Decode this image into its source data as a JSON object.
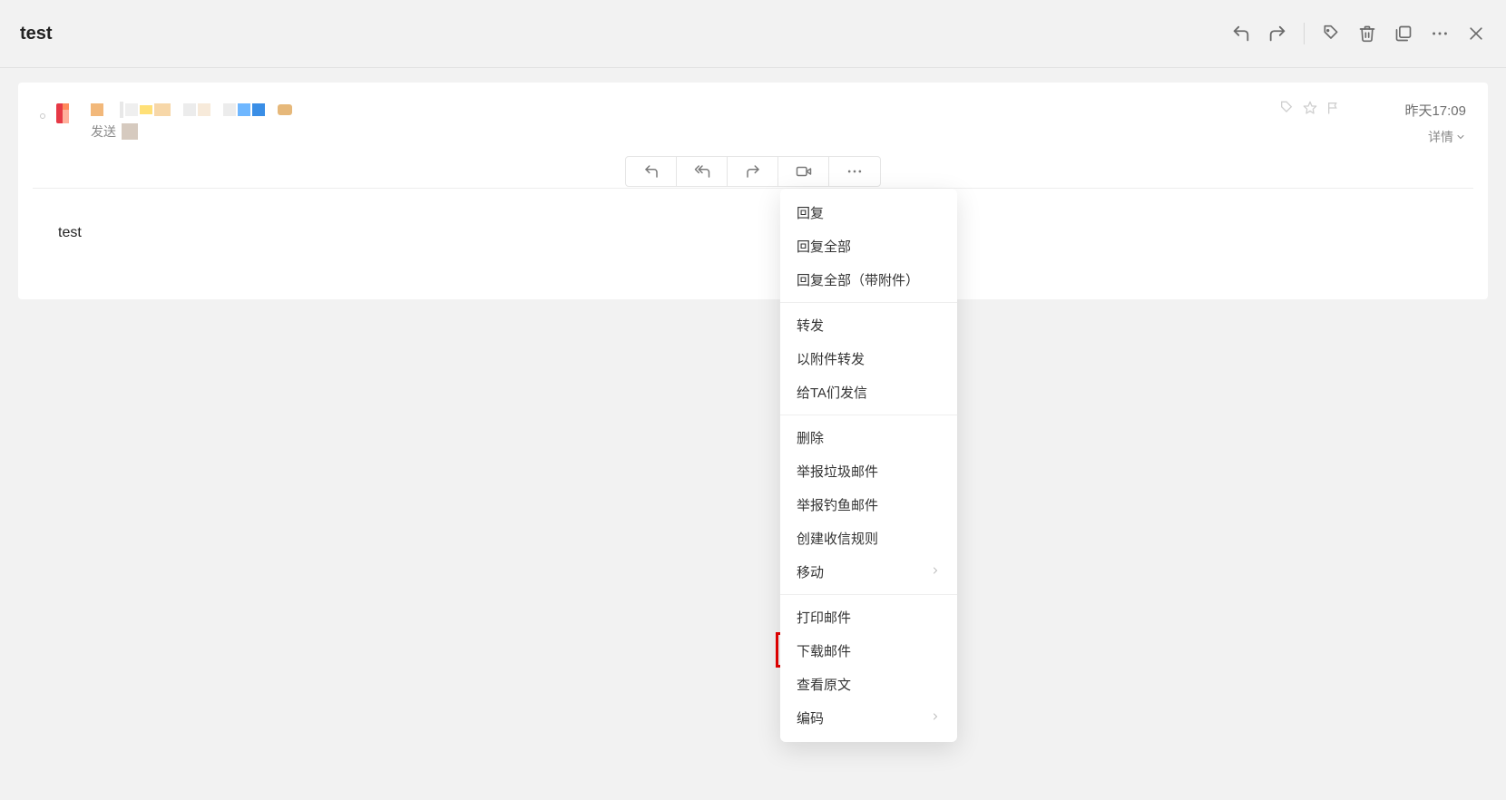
{
  "header": {
    "title": "test"
  },
  "mail": {
    "recipient_label": "发送",
    "time": "昨天17:09",
    "details": "详情",
    "body": "test"
  },
  "dropdown": {
    "group1": [
      "回复",
      "回复全部",
      "回复全部（带附件）"
    ],
    "group2": [
      "转发",
      "以附件转发",
      "给TA们发信"
    ],
    "group3": [
      "删除",
      "举报垃圾邮件",
      "举报钓鱼邮件",
      "创建收信规则"
    ],
    "move": "移动",
    "group4": [
      "打印邮件",
      "下载邮件",
      "查看原文"
    ],
    "encoding": "编码"
  }
}
